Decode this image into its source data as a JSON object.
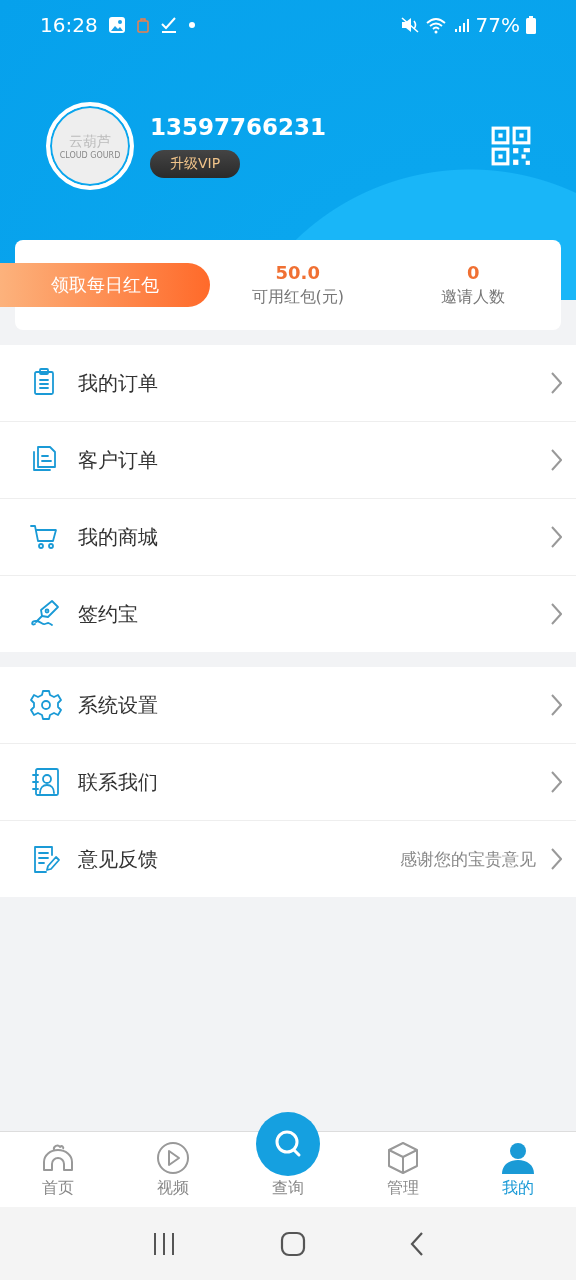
{
  "status_bar": {
    "time": "16:28",
    "battery": "77%"
  },
  "profile": {
    "logo_text": "云葫芦",
    "logo_subtext": "CLOUD GOURD",
    "phone": "13597766231",
    "vip_button": "升级VIP"
  },
  "summary": {
    "daily_button": "领取每日红包",
    "stats": [
      {
        "value": "50.0",
        "label": "可用红包(元)"
      },
      {
        "value": "0",
        "label": "邀请人数"
      }
    ]
  },
  "menu_groups": [
    {
      "items": [
        {
          "label": "我的订单"
        },
        {
          "label": "客户订单"
        },
        {
          "label": "我的商城"
        },
        {
          "label": "签约宝"
        }
      ]
    },
    {
      "items": [
        {
          "label": "系统设置"
        },
        {
          "label": "联系我们"
        },
        {
          "label": "意见反馈",
          "hint": "感谢您的宝贵意见"
        }
      ]
    }
  ],
  "tab_bar": [
    {
      "label": "首页",
      "kind": "normal",
      "selected": false
    },
    {
      "label": "视频",
      "kind": "normal",
      "selected": false
    },
    {
      "label": "查询",
      "kind": "raised",
      "selected": false
    },
    {
      "label": "管理",
      "kind": "normal",
      "selected": false
    },
    {
      "label": "我的",
      "kind": "normal",
      "selected": true
    }
  ]
}
